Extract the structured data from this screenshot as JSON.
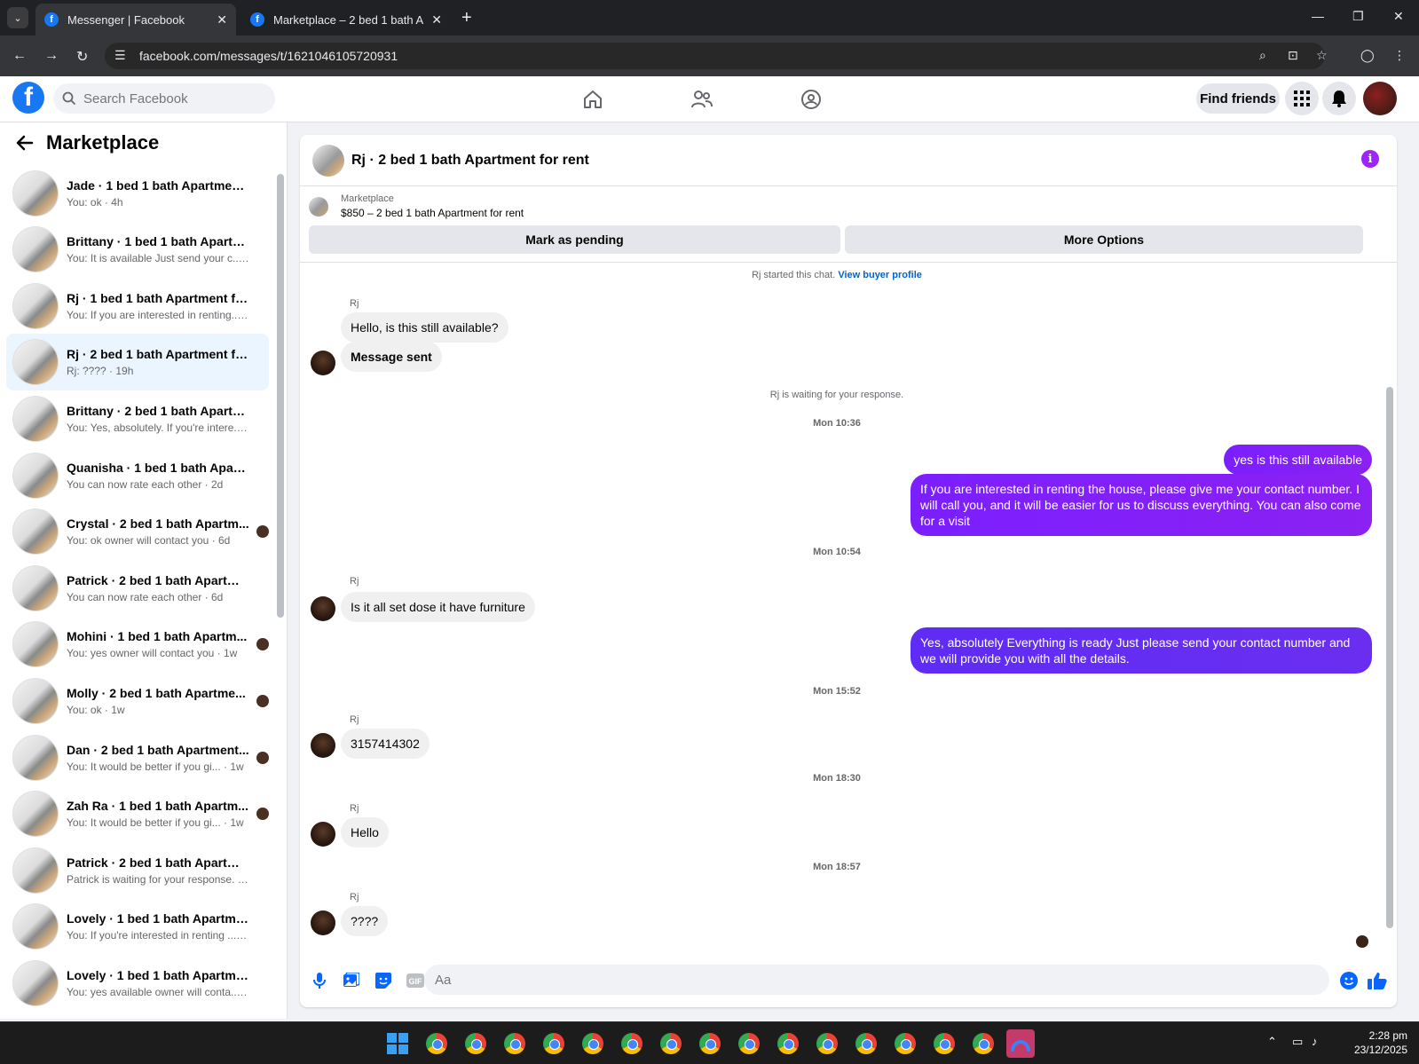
{
  "browser": {
    "tabs": [
      {
        "label": "Messenger | Facebook",
        "active": true
      },
      {
        "label": "Marketplace – 2 bed 1 bath Ap",
        "active": false
      }
    ],
    "url": "facebook.com/messages/t/1621046105720931"
  },
  "header": {
    "search_placeholder": "Search Facebook",
    "find_friends": "Find friends"
  },
  "sidebar": {
    "title": "Marketplace",
    "conversations": [
      {
        "name": "Jade · 1 bed 1 bath Apartment f...",
        "preview": "You: ok · 4h"
      },
      {
        "name": "Brittany · 1 bed 1 bath Apartmen...",
        "preview": "You: It is available Just send your c... · 4h"
      },
      {
        "name": "Rj · 1 bed 1 bath Apartment for r...",
        "preview": "You: If you are interested in renting... · 4h"
      },
      {
        "name": "Rj · 2 bed 1 bath Apartment for ...",
        "preview": "Rj: ???? · 19h"
      },
      {
        "name": "Brittany · 2 bed 1 bath Apartme...",
        "preview": "You: Yes, absolutely. If you're intere... 1d"
      },
      {
        "name": "Quanisha · 1 bed 1 bath Apartm...",
        "preview": "You can now rate each other · 2d"
      },
      {
        "name": "Crystal · 2 bed 1 bath Apartm...",
        "preview": "You: ok owner will contact you · 6d"
      },
      {
        "name": "Patrick · 2 bed 1 bath Apartment...",
        "preview": "You can now rate each other · 6d"
      },
      {
        "name": "Mohini · 1 bed 1 bath Apartm...",
        "preview": "You: yes owner will contact you · 1w"
      },
      {
        "name": "Molly · 2 bed 1 bath Apartme...",
        "preview": "You: ok · 1w"
      },
      {
        "name": "Dan · 2 bed 1 bath Apartment...",
        "preview": "You: It would be better if you gi... · 1w"
      },
      {
        "name": "Zah Ra · 1 bed 1 bath Apartm...",
        "preview": "You: It would be better if you gi... · 1w"
      },
      {
        "name": "Patrick · 2 bed 1 bath Apartment...",
        "preview": "Patrick is waiting for your response. · 1w"
      },
      {
        "name": "Lovely · 1 bed 1 bath Apartment ...",
        "preview": "You: If you're interested in renting ... · 1w"
      },
      {
        "name": "Lovely · 1 bed 1 bath Apartment ...",
        "preview": "You: yes available owner will conta... · 1w"
      }
    ]
  },
  "chat": {
    "title": "Rj · 2 bed 1 bath Apartment for rent",
    "listing_source": "Marketplace",
    "listing_title": "$850 – 2 bed 1 bath Apartment for rent",
    "mark_pending": "Mark as pending",
    "more_options": "More Options",
    "started_text": "Rj started this chat.",
    "view_profile": "View buyer profile",
    "waiting_text": "Rj is waiting for your response.",
    "sender_name": "Rj",
    "msg_hello_available": "Hello, is this still available?",
    "msg_sent": "Message sent",
    "ts1": "Mon 10:36",
    "msg_yes_available": "yes is this still available",
    "msg_interested": "If you are interested in renting the house, please give me your contact number. I will call you, and it will be easier for us to discuss everything. You can also come for a visit",
    "ts2": "Mon 10:54",
    "msg_furniture": "Is it all set dose it have furniture",
    "msg_absolutely": "Yes, absolutely Everything is ready Just please send your contact number and we will provide you with all the details.",
    "ts3": "Mon 15:52",
    "msg_number": "3157414302",
    "ts4": "Mon 18:30",
    "msg_hello": "Hello",
    "ts5": "Mon 18:57",
    "msg_question": "????",
    "input_placeholder": "Aa"
  },
  "taskbar": {
    "time": "2:28 pm",
    "date": "23/12/2025"
  },
  "colors": {
    "facebook_blue": "#1877f2",
    "outgoing_purple": "#8b21f2",
    "outgoing_blue": "#5e2cf5",
    "info_purple": "#9d26f6"
  }
}
